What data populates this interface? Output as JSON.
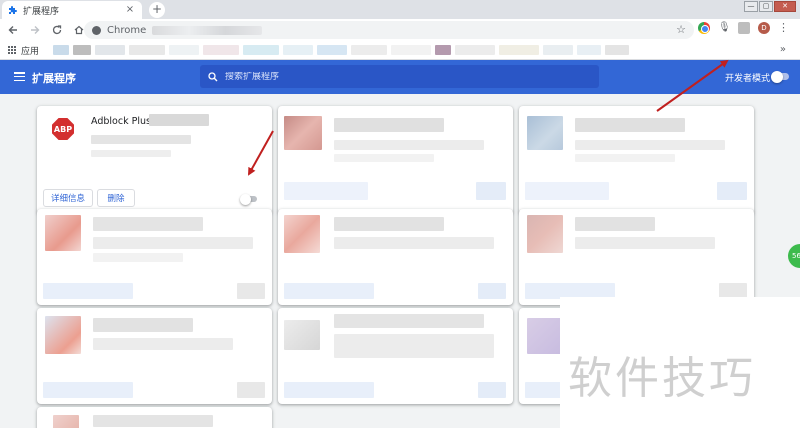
{
  "browser": {
    "tab_title": "扩展程序",
    "tab_close": "×",
    "new_tab": "+",
    "url_scheme": "Chrome",
    "profile_initial": "D",
    "window_controls": [
      "—",
      "▢",
      "✕"
    ]
  },
  "bookmarks": {
    "apps_label": "应用",
    "more": "»"
  },
  "header": {
    "title": "扩展程序",
    "search_placeholder": "搜索扩展程序",
    "dev_mode_label": "开发者模式",
    "dev_mode_enabled": false
  },
  "extension": {
    "icon_text": "ABP",
    "name": "Adblock Plus -",
    "details_button": "详细信息",
    "remove_button": "删除",
    "enabled": false
  },
  "watermark": "软件技巧",
  "side_badge": "56",
  "colors": {
    "header_blue": "#3367d6",
    "page_bg": "#f1f3f4",
    "arrow_red": "#c0201f"
  }
}
